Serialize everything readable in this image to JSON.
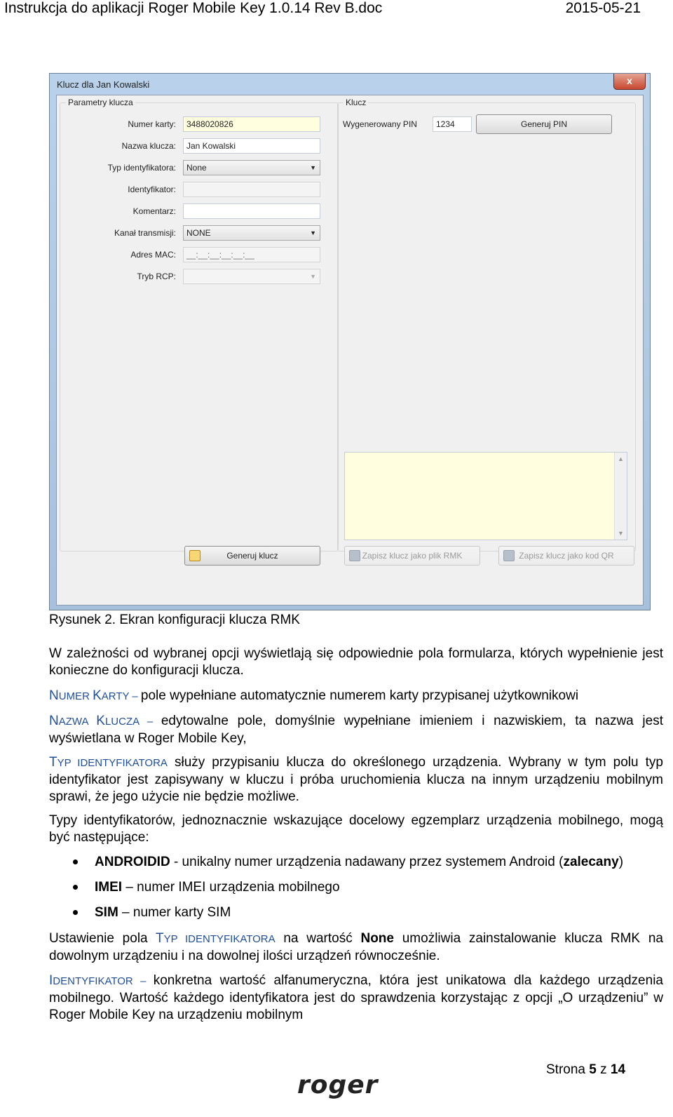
{
  "header": {
    "left": "Instrukcja do aplikacji Roger Mobile Key 1.0.14 Rev B.doc",
    "right": "2015-05-21"
  },
  "window": {
    "title": "Klucz dla Jan Kowalski",
    "close_glyph": "x",
    "params": {
      "title": "Parametry klucza",
      "card_label": "Numer karty:",
      "card_value": "3488020826",
      "name_label": "Nazwa klucza:",
      "name_value": "Jan Kowalski",
      "idtype_label": "Typ identyfikatora:",
      "idtype_value": "None",
      "id_label": "Identyfikator:",
      "id_value": "",
      "comment_label": "Komentarz:",
      "comment_value": "",
      "channel_label": "Kanał transmisji:",
      "channel_value": "NONE",
      "mac_label": "Adres MAC:",
      "mac_value": "__:__:__:__:__:__",
      "rcp_label": "Tryb RCP:",
      "rcp_value": "",
      "generate_key": "Generuj klucz"
    },
    "key": {
      "title": "Klucz",
      "pin_label": "Wygenerowany PIN",
      "pin_value": "1234",
      "generate_pin": "Generuj PIN",
      "save_rmk": "Zapisz klucz jako plik RMK",
      "save_qr": "Zapisz klucz jako kod QR"
    }
  },
  "caption": "Rysunek 2. Ekran konfiguracji klucza RMK",
  "para1": "W zależności od wybranej opcji wyświetlają się odpowiednie pola formularza, których wypełnienie jest konieczne do konfiguracji klucza.",
  "numer": {
    "t1": "N",
    "t2": "UMER ",
    "t3": "K",
    "t4": "ARTY",
    "dash": " – ",
    "text": "pole wypełniane automatycznie numerem karty przypisanej użytkownikowi"
  },
  "nazwa": {
    "t1": "N",
    "t2": "AZWA ",
    "t3": "K",
    "t4": "LUCZA",
    "dash": " – ",
    "text": " edytowalne pole, domyślnie wypełniane imieniem i nazwiskiem, ta nazwa jest wyświetlana w Roger Mobile Key,"
  },
  "typ": {
    "t1": "T",
    "t2": "YP IDENTYFIKATORA",
    "text": " służy przypisaniu klucza do określonego urządzenia. Wybrany w tym polu typ identyfikator jest zapisywany w kluczu i próba uruchomienia klucza na innym urządzeniu mobilnym sprawi, że jego użycie nie będzie możliwe."
  },
  "para_types": "Typy identyfikatorów, jednoznacznie wskazujące docelowy egzemplarz urządzenia mobilnego, mogą być następujące:",
  "bullets": {
    "b1_bold": "ANDROIDID",
    "b1_text": " - unikalny numer urządzenia nadawany przez systemem Android (",
    "b1_bold2": "zalecany",
    "b1_end": ")",
    "b2_bold": "IMEI",
    "b2_text": " – numer IMEI urządzenia mobilnego",
    "b3_bold": "SIM",
    "b3_text": " – numer karty SIM"
  },
  "ustaw": {
    "a": "Ustawienie pola ",
    "t1": "T",
    "t2": "YP IDENTYFIKATORA",
    "b": " na wartość ",
    "none": "None",
    "c": " umożliwia zainstalowanie klucza RMK na dowolnym urządzeniu i na dowolnej ilości urządzeń równocześnie."
  },
  "ident": {
    "t1": "I",
    "t2": "DENTYFIKATOR",
    "dash": " – ",
    "text": "konkretna wartość alfanumeryczna, która jest unikatowa dla każdego urządzenia mobilnego. Wartość każdego identyfikatora jest do sprawdzenia korzystając z opcji „O urządzeniu” w Roger Mobile Key na urządzeniu mobilnym"
  },
  "footer": {
    "page_prefix": "Strona ",
    "page": "5",
    "of": " z ",
    "total": "14",
    "logo": "roger"
  }
}
